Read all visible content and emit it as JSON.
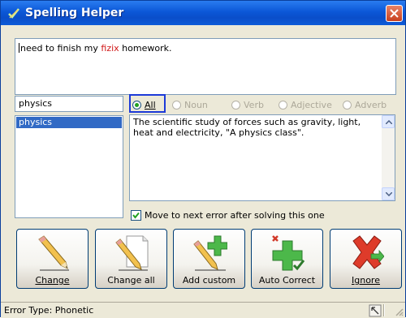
{
  "window": {
    "title": "Spelling Helper"
  },
  "sentence": {
    "before": "need to finish my ",
    "error_word": "fizix",
    "after": " homework."
  },
  "word_input": {
    "value": "physics"
  },
  "suggestions": [
    "physics"
  ],
  "part_of_speech": [
    {
      "label": "All",
      "selected": true,
      "enabled": true
    },
    {
      "label": "Noun",
      "selected": false,
      "enabled": false
    },
    {
      "label": "Verb",
      "selected": false,
      "enabled": false
    },
    {
      "label": "Adjective",
      "selected": false,
      "enabled": false
    },
    {
      "label": "Adverb",
      "selected": false,
      "enabled": false
    }
  ],
  "definition": "The scientific study of forces such as gravity, light, heat and electricity, \"A physics class\".",
  "move_next": {
    "label": "Move to next error after solving this one",
    "checked": true
  },
  "buttons": {
    "change": "Change",
    "change_all": "Change all",
    "add_custom": "Add custom",
    "auto_correct": "Auto Correct",
    "ignore": "Ignore"
  },
  "status": {
    "text": "Error Type: Phonetic"
  },
  "colors": {
    "title_bar": "#0b57d7",
    "error_text": "#d01818",
    "selection": "#316ac5",
    "focus": "#1c3ad8"
  }
}
